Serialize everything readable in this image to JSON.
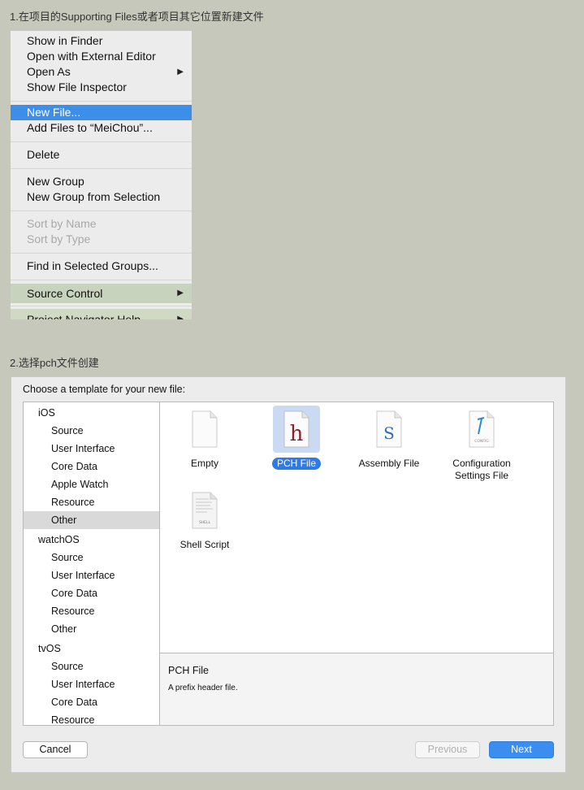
{
  "steps": {
    "step1": "1.在项目的Supporting Files或者项目其它位置新建文件",
    "step2": "2.选择pch文件创建"
  },
  "context_menu": {
    "groups": [
      [
        "Show in Finder",
        "Open with External Editor",
        "Open As",
        "Show File Inspector"
      ],
      [
        "New File...",
        "Add Files to “MeiChou”..."
      ],
      [
        "Delete"
      ],
      [
        "New Group",
        "New Group from Selection"
      ],
      [
        "Sort by Name",
        "Sort by Type"
      ],
      [
        "Find in Selected Groups..."
      ],
      [
        "Source Control"
      ],
      [
        "Project Navigator Help"
      ]
    ],
    "selected": "New File...",
    "submenu_arrow": "▶"
  },
  "dialog": {
    "title": "Choose a template for your new file:",
    "sidebar": [
      {
        "platform": "iOS",
        "items": [
          "Source",
          "User Interface",
          "Core Data",
          "Apple Watch",
          "Resource",
          "Other"
        ]
      },
      {
        "platform": "watchOS",
        "items": [
          "Source",
          "User Interface",
          "Core Data",
          "Resource",
          "Other"
        ]
      },
      {
        "platform": "tvOS",
        "items": [
          "Source",
          "User Interface",
          "Core Data",
          "Resource"
        ]
      }
    ],
    "selected_category": "iOS / Other",
    "templates": [
      {
        "label": "Empty",
        "icon": "empty-file-icon"
      },
      {
        "label": "PCH File",
        "icon": "header-file-icon",
        "glyph": "h",
        "selected": true
      },
      {
        "label": "Assembly File",
        "icon": "assembly-file-icon",
        "glyph": "S"
      },
      {
        "label": "Configuration\nSettings File",
        "icon": "config-file-icon",
        "glyph": "CONFIG"
      },
      {
        "label": "Shell Script",
        "icon": "shell-script-icon",
        "glyph": "SHELL"
      }
    ],
    "description": {
      "title": "PCH File",
      "text": "A prefix header file."
    },
    "buttons": {
      "cancel": "Cancel",
      "previous": "Previous",
      "next": "Next"
    }
  },
  "colors": {
    "background": "#c5c8bb",
    "selection": "#3d8ee8",
    "primary_button": "#3b8ef0"
  }
}
